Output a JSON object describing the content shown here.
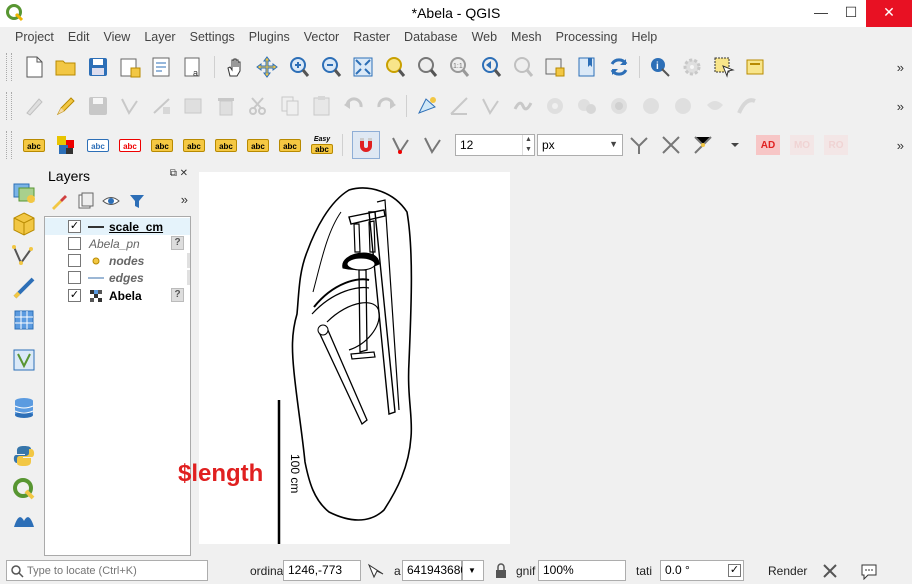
{
  "window": {
    "title": "*Abela - QGIS",
    "minimize": "—",
    "maximize": "☐",
    "close": "✕"
  },
  "menubar": [
    "Project",
    "Edit",
    "View",
    "Layer",
    "Settings",
    "Plugins",
    "Vector",
    "Raster",
    "Database",
    "Web",
    "Mesh",
    "Processing",
    "Help"
  ],
  "snapping": {
    "tolerance": "12",
    "units": "px"
  },
  "toolbar_more": "»",
  "label_toolbar": {
    "abc": "abc",
    "easy_top": "Easy",
    "easy_bottom": "abc",
    "ad": "AD",
    "mo": "MO",
    "ro": "RO"
  },
  "layers_panel": {
    "title": "Layers",
    "more": "»",
    "layers": [
      {
        "name": "scale_cm",
        "checked": true
      },
      {
        "name": "Abela_pn",
        "checked": false
      },
      {
        "name": "nodes",
        "checked": false
      },
      {
        "name": "edges",
        "checked": false
      },
      {
        "name": "Abela",
        "checked": true
      }
    ],
    "check_mark": "✓",
    "q_badge": "?"
  },
  "map": {
    "length_label": "$length",
    "scale_label": "100 cm"
  },
  "statusbar": {
    "locator_placeholder": "Type to locate (Ctrl+K)",
    "coordinate_label": "ordina",
    "coordinate": "1246,-773",
    "scale_label": "a",
    "scale": "641943680",
    "magnifier_label": "gnif",
    "magnifier": "100%",
    "rotation_label": "tati",
    "rotation": "0.0 °",
    "render_label": "Render"
  },
  "colors": {
    "accent_red": "#e02020",
    "qgis_green": "#589632",
    "close_red": "#e81123"
  }
}
